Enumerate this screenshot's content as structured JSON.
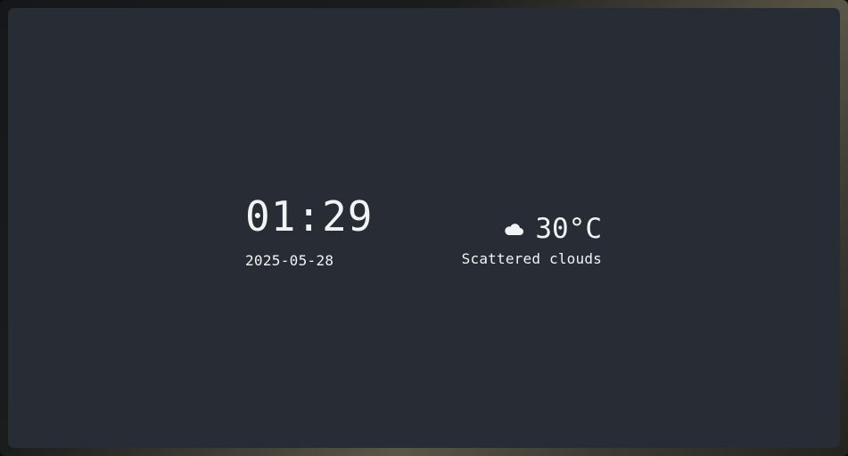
{
  "clock": {
    "time": "01:29",
    "date": "2025-05-28"
  },
  "weather": {
    "icon": "cloud-icon",
    "temperature": "30°C",
    "description": "Scattered clouds"
  },
  "colors": {
    "background": "#272c35",
    "text": "#f2f3f5"
  }
}
